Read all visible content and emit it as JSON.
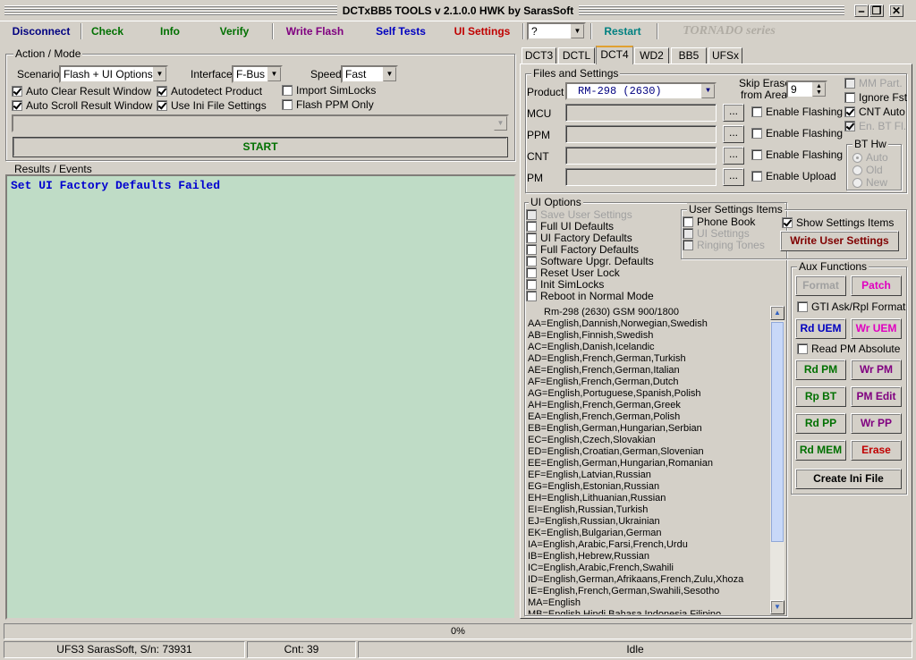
{
  "window": {
    "title": "DCTxBB5 TOOLS v 2.1.0.0 HWK by SarasSoft",
    "minimize": "⎯",
    "restore": "❐",
    "close": "✕"
  },
  "toolbar": {
    "disconnect": "Disconnect",
    "check": "Check",
    "info": "Info",
    "verify": "Verify",
    "write_flash": "Write Flash",
    "self_tests": "Self Tests",
    "ui_settings": "UI Settings",
    "help_select": "?",
    "restart": "Restart",
    "brand": "TORNADO series"
  },
  "colors": {
    "green": "#007000",
    "purple": "#800080",
    "blue": "#0000c0",
    "red": "#c00000",
    "teal": "#008080",
    "results_bg": "#bfdcc6"
  },
  "action": {
    "group_label": "Action / Mode",
    "scenario_label": "Scenario",
    "scenario_value": "Flash + UI Options",
    "interface_label": "Interface",
    "interface_value": "F-Bus",
    "speed_label": "Speed",
    "speed_value": "Fast",
    "auto_clear": "Auto Clear Result Window",
    "autodetect": "Autodetect Product",
    "import_simlocks": "Import SimLocks",
    "auto_scroll": "Auto Scroll Result Window",
    "use_ini": "Use Ini File Settings",
    "flash_ppm_only": "Flash PPM Only",
    "start": "START"
  },
  "results": {
    "label": "Results / Events",
    "text": "Set UI Factory Defaults Failed"
  },
  "tabs": [
    "DCT3",
    "DCTL",
    "DCT4",
    "WD2",
    "BB5",
    "UFSx"
  ],
  "files": {
    "group_label": "Files and Settings",
    "product_label": "Product",
    "product_value": "RM-298 (2630)",
    "skip_erase_1": "Skip Erase",
    "skip_erase_2": "from Area",
    "skip_value": "9",
    "mcu": "MCU",
    "ppm": "PPM",
    "cnt": "CNT",
    "pm": "PM",
    "browse": "...",
    "enable_flashing": "Enable Flashing",
    "enable_upload": "Enable Upload",
    "mm_part": "MM Part.",
    "ignore_fst": "Ignore Fst",
    "cnt_auto": "CNT Auto",
    "en_bt_fl": "En. BT Fl.",
    "bt_hw_label": "BT Hw",
    "bt_auto": "Auto",
    "bt_old": "Old",
    "bt_new": "New"
  },
  "ui_options": {
    "group_label": "UI Options",
    "items": [
      {
        "label": "Save User Settings",
        "disabled": true
      },
      {
        "label": "Full UI Defaults",
        "disabled": false
      },
      {
        "label": "UI Factory Defaults",
        "disabled": false
      },
      {
        "label": "Full Factory Defaults",
        "disabled": false
      },
      {
        "label": "Software Upgr. Defaults",
        "disabled": false
      },
      {
        "label": "Reset User Lock",
        "disabled": false
      },
      {
        "label": "Init SimLocks",
        "disabled": false
      },
      {
        "label": "Reboot in Normal Mode",
        "disabled": false
      }
    ]
  },
  "user_settings": {
    "group_label": "User Settings Items",
    "phone_book": "Phone Book",
    "ui_settings": "UI Settings",
    "ringing_tones": "Ringing Tones",
    "show_items": "Show Settings Items",
    "write_button": "Write User Settings"
  },
  "languages": {
    "header": "Rm-298 (2630) GSM 900/1800",
    "lines": [
      "AA=English,Dannish,Norwegian,Swedish",
      "AB=English,Finnish,Swedish",
      "AC=English,Danish,Icelandic",
      "AD=English,French,German,Turkish",
      "AE=English,French,German,Italian",
      "AF=English,French,German,Dutch",
      "AG=English,Portuguese,Spanish,Polish",
      "AH=English,French,German,Greek",
      "EA=English,French,German,Polish",
      "EB=English,German,Hungarian,Serbian",
      "EC=English,Czech,Slovakian",
      "ED=English,Croatian,German,Slovenian",
      "EE=English,German,Hungarian,Romanian",
      "EF=English,Latvian,Russian",
      "EG=English,Estonian,Russian",
      "EH=English,Lithuanian,Russian",
      "EI=English,Russian,Turkish",
      "EJ=English,Russian,Ukrainian",
      "EK=English,Bulgarian,German",
      "IA=English,Arabic,Farsi,French,Urdu",
      "IB=English,Hebrew,Russian",
      "IC=English,Arabic,French,Swahili",
      "ID=English,German,Afrikaans,French,Zulu,Xhoza",
      "IE=English,French,German,Swahili,Sesotho",
      "MA=English",
      "MB=English,Hindi,Bahasa Indonesia,Filipino"
    ]
  },
  "aux": {
    "group_label": "Aux Functions",
    "format": "Format",
    "patch": "Patch",
    "gti": "GTI Ask/Rpl Format",
    "rd_uem": "Rd UEM",
    "wr_uem": "Wr UEM",
    "read_pm_abs": "Read PM Absolute",
    "rd_pm": "Rd PM",
    "wr_pm": "Wr PM",
    "rp_bt": "Rp BT",
    "pm_edit": "PM Edit",
    "rd_pp": "Rd PP",
    "wr_pp": "Wr PP",
    "rd_mem": "Rd MEM",
    "erase": "Erase",
    "create_ini": "Create Ini File"
  },
  "progress": {
    "value": 0,
    "text": "0%"
  },
  "status": {
    "device": "UFS3 SarasSoft, S/n: 73931",
    "cnt": "Cnt: 39",
    "state": "Idle"
  }
}
